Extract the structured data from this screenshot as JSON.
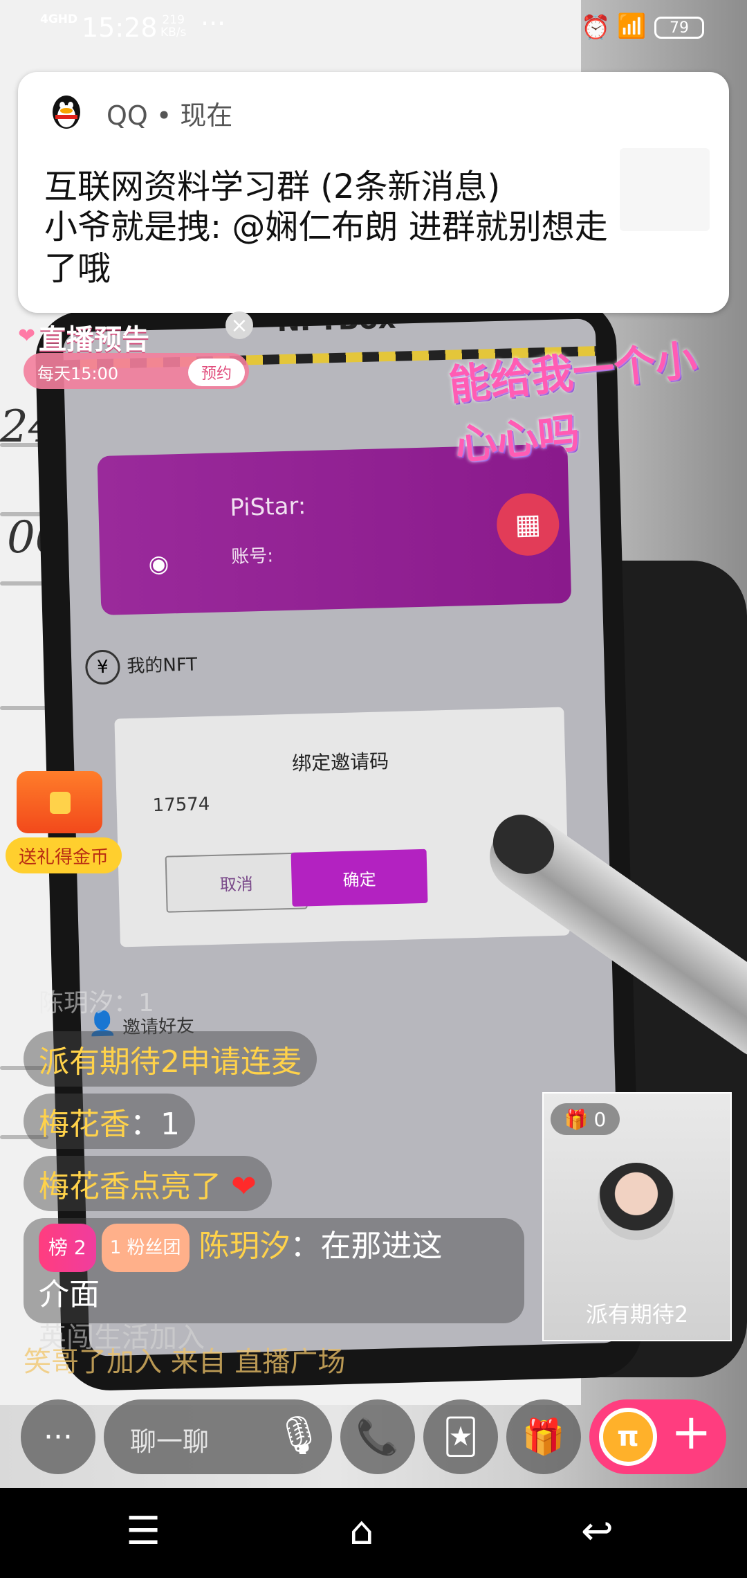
{
  "status_bar": {
    "network": "4GHD",
    "time": "15:28",
    "speed_value": "219",
    "speed_unit": "KB/s",
    "more": "···",
    "battery": "79"
  },
  "notification": {
    "app_name": "QQ",
    "when": "现在",
    "title": "互联网资料学习群 (2条新消息)",
    "body": "小爷就是拽: @娴仁布朗 进群就别想走了哦"
  },
  "live_preview": {
    "label": "直播预告",
    "time": "每天15:00",
    "reserve": "预约",
    "close": "×"
  },
  "sticker_text": "能给我一个小心心吗",
  "treasure": {
    "label": "送礼得金币"
  },
  "phone_screen": {
    "app_title": "NFTBox",
    "card_name": "PiStar:",
    "card_account": "账号:",
    "my_nft": "我的NFT",
    "dialog_title": "绑定邀请码",
    "invite_code": "17574",
    "cancel": "取消",
    "confirm": "确定",
    "invite_friends": "邀请好友"
  },
  "chat": {
    "faded_top": "陈玥汐：1",
    "messages": [
      {
        "text": "派有期待2申请连麦"
      },
      {
        "user": "梅花香",
        "sep": "：",
        "content": "1"
      },
      {
        "user": "梅花香",
        "content": "点亮了",
        "heart": "❤"
      }
    ],
    "rich_message": {
      "rank": "榜 2",
      "fan_level": "1",
      "fan_label": "粉丝团",
      "user": "陈玥汐",
      "sep": "：",
      "content_line1": "在那进这",
      "content_line2": "介面"
    },
    "join_line": "笑哥了加入  来自 直播广场",
    "join_faded": "英闯生活加入"
  },
  "cohost": {
    "gift_count": "0",
    "name": "派有期待2"
  },
  "toolbar": {
    "more": "···",
    "input_placeholder": "聊一聊"
  },
  "colors": {
    "accent_pink": "#ff3d7f",
    "dialog_confirm": "#b322c1",
    "chat_username": "#ffd24a"
  }
}
